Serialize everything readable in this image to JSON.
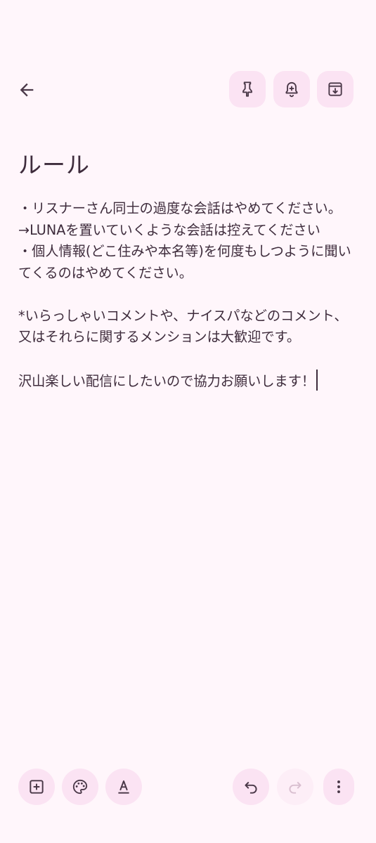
{
  "note": {
    "title": "ルール",
    "body": "・リスナーさん同士の過度な会話はやめてください。\n→LUNAを置いていくような会話は控えてください\n・個人情報(どこ住みや本名等)を何度もしつように聞いてくるのはやめてください。\n\n*いらっしゃいコメントや、ナイスパなどのコメント、又はそれらに関するメンションは大歓迎です。\n\n沢山楽しい配信にしたいので協力お願いします！"
  },
  "icons": {
    "back": "arrow-back-icon",
    "pin": "pin-icon",
    "reminder": "bell-plus-icon",
    "archive": "archive-icon",
    "add": "add-box-icon",
    "palette": "palette-icon",
    "text_format": "text-format-icon",
    "undo": "undo-icon",
    "redo": "redo-icon",
    "more": "more-vert-icon"
  },
  "colors": {
    "background": "#FFF6FB",
    "button_fill": "#FBE3F3",
    "icon": "#4A3848",
    "text": "#3E2C3C",
    "disabled_icon": "#D9BFD0"
  }
}
